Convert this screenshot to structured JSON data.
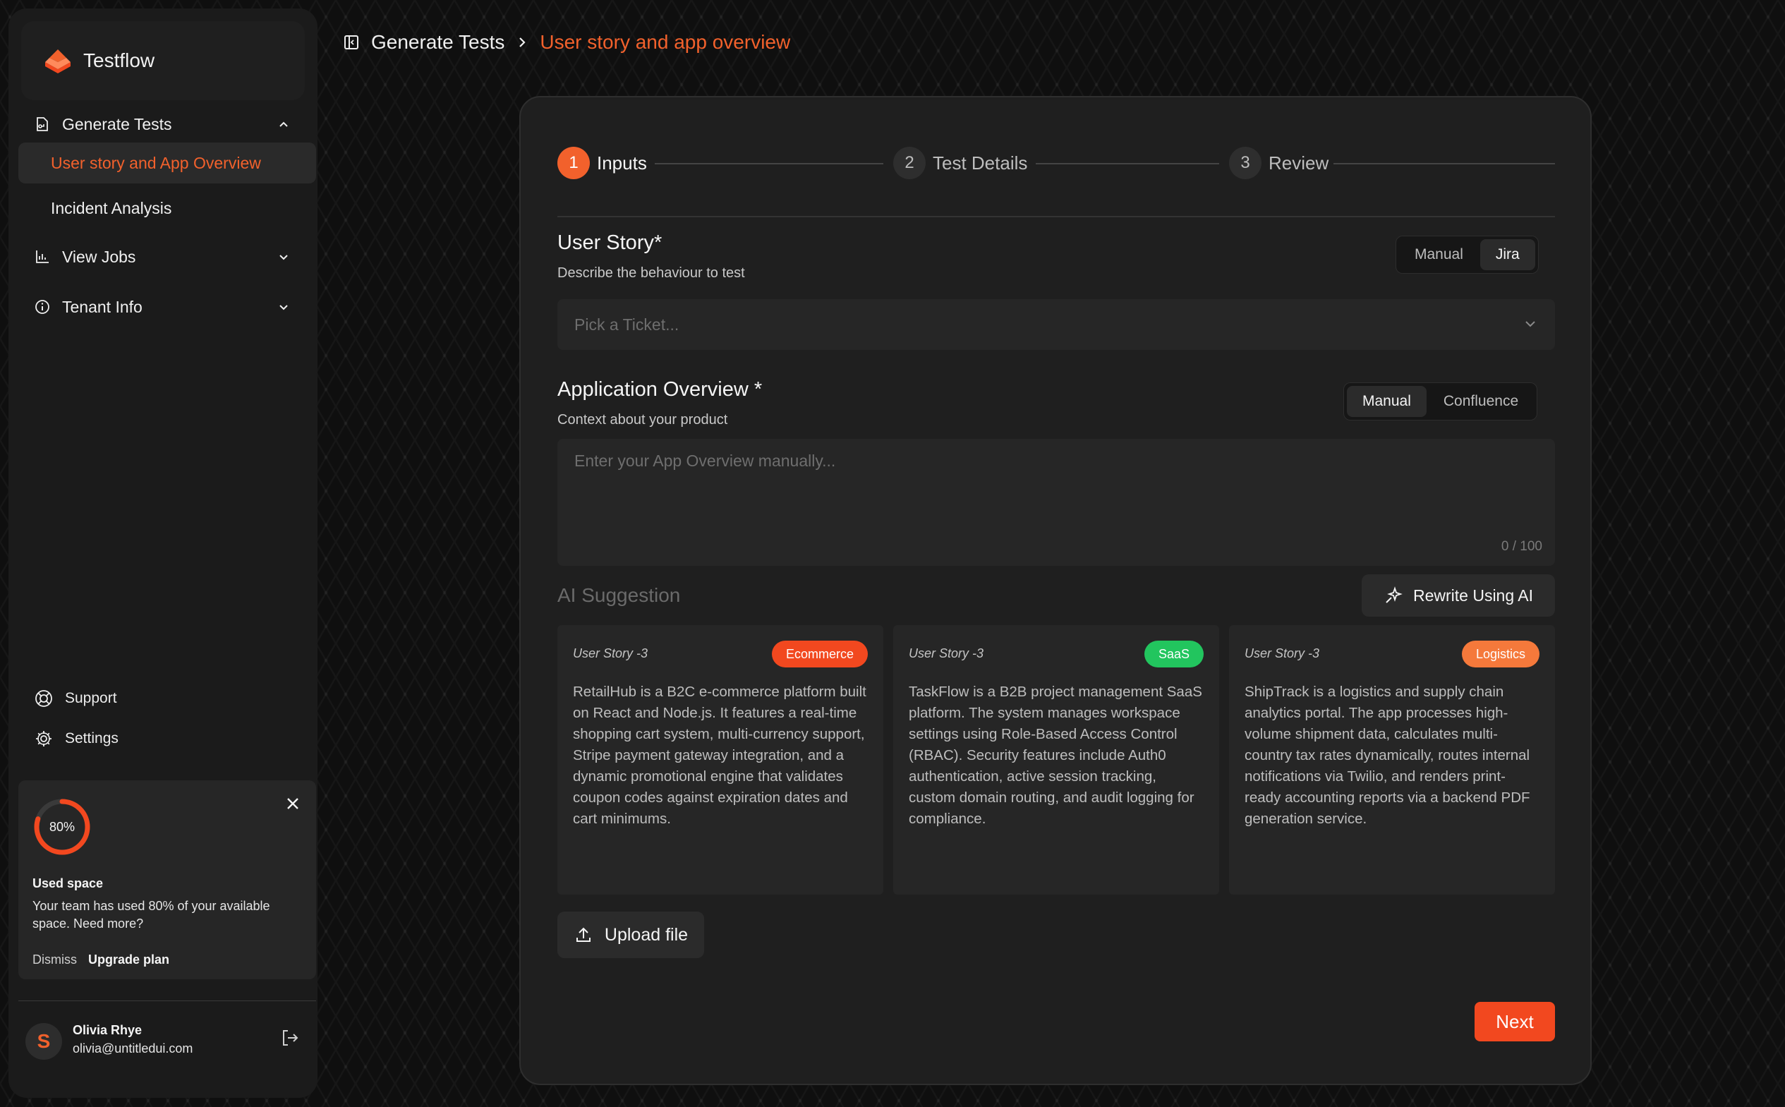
{
  "app": {
    "name": "Testflow"
  },
  "colors": {
    "accent": "#f2612c",
    "ecommerce": "#f2481f",
    "saas": "#22c55e",
    "logistics": "#f5793b"
  },
  "sidebar": {
    "generate_tests": "Generate Tests",
    "sub_items": [
      "User story and App Overview",
      "Incident Analysis"
    ],
    "view_jobs": "View Jobs",
    "tenant_info": "Tenant Info",
    "support": "Support",
    "settings": "Settings"
  },
  "usage": {
    "percent_label": "80%",
    "percent": 80,
    "title": "Used space",
    "text": "Your team has used 80% of your available space. Need more?",
    "dismiss": "Dismiss",
    "upgrade": "Upgrade plan"
  },
  "user": {
    "initial": "S",
    "name": "Olivia Rhye",
    "email": "olivia@untitledui.com"
  },
  "breadcrumb": {
    "parent": "Generate Tests",
    "current": "User story and app overview"
  },
  "stepper": {
    "steps": [
      {
        "num": "1",
        "label": "Inputs"
      },
      {
        "num": "2",
        "label": "Test Details"
      },
      {
        "num": "3",
        "label": "Review"
      }
    ]
  },
  "user_story": {
    "title": "User Story*",
    "subtitle": "Describe the behaviour to test",
    "toggle": [
      "Manual",
      "Jira"
    ],
    "placeholder": "Pick a Ticket..."
  },
  "app_overview": {
    "title": "Application Overview *",
    "subtitle": "Context about your product",
    "toggle": [
      "Manual",
      "Confluence"
    ],
    "placeholder": "Enter your App Overview manually...",
    "count": "0 / 100"
  },
  "ai": {
    "title": "AI Suggestion",
    "rewrite": "Rewrite Using AI",
    "cards": [
      {
        "head": "User Story -3",
        "tag": "Ecommerce",
        "body": "RetailHub is a B2C e-commerce platform built on React and Node.js. It features a real-time shopping cart system, multi-currency support, Stripe payment gateway integration, and a dynamic promotional engine that validates coupon codes against expiration dates and cart minimums."
      },
      {
        "head": "User Story -3",
        "tag": "SaaS",
        "body": "TaskFlow is a B2B project management SaaS platform. The system manages workspace settings using Role-Based Access Control (RBAC). Security features include Auth0 authentication, active session tracking, custom domain routing, and audit logging for compliance."
      },
      {
        "head": "User Story -3",
        "tag": "Logistics",
        "body": "ShipTrack is a logistics and supply chain analytics portal. The app processes high-volume shipment data, calculates multi-country tax rates dynamically, routes internal notifications via Twilio, and renders print-ready accounting reports via a backend PDF generation service."
      }
    ]
  },
  "actions": {
    "upload": "Upload file",
    "next": "Next"
  }
}
